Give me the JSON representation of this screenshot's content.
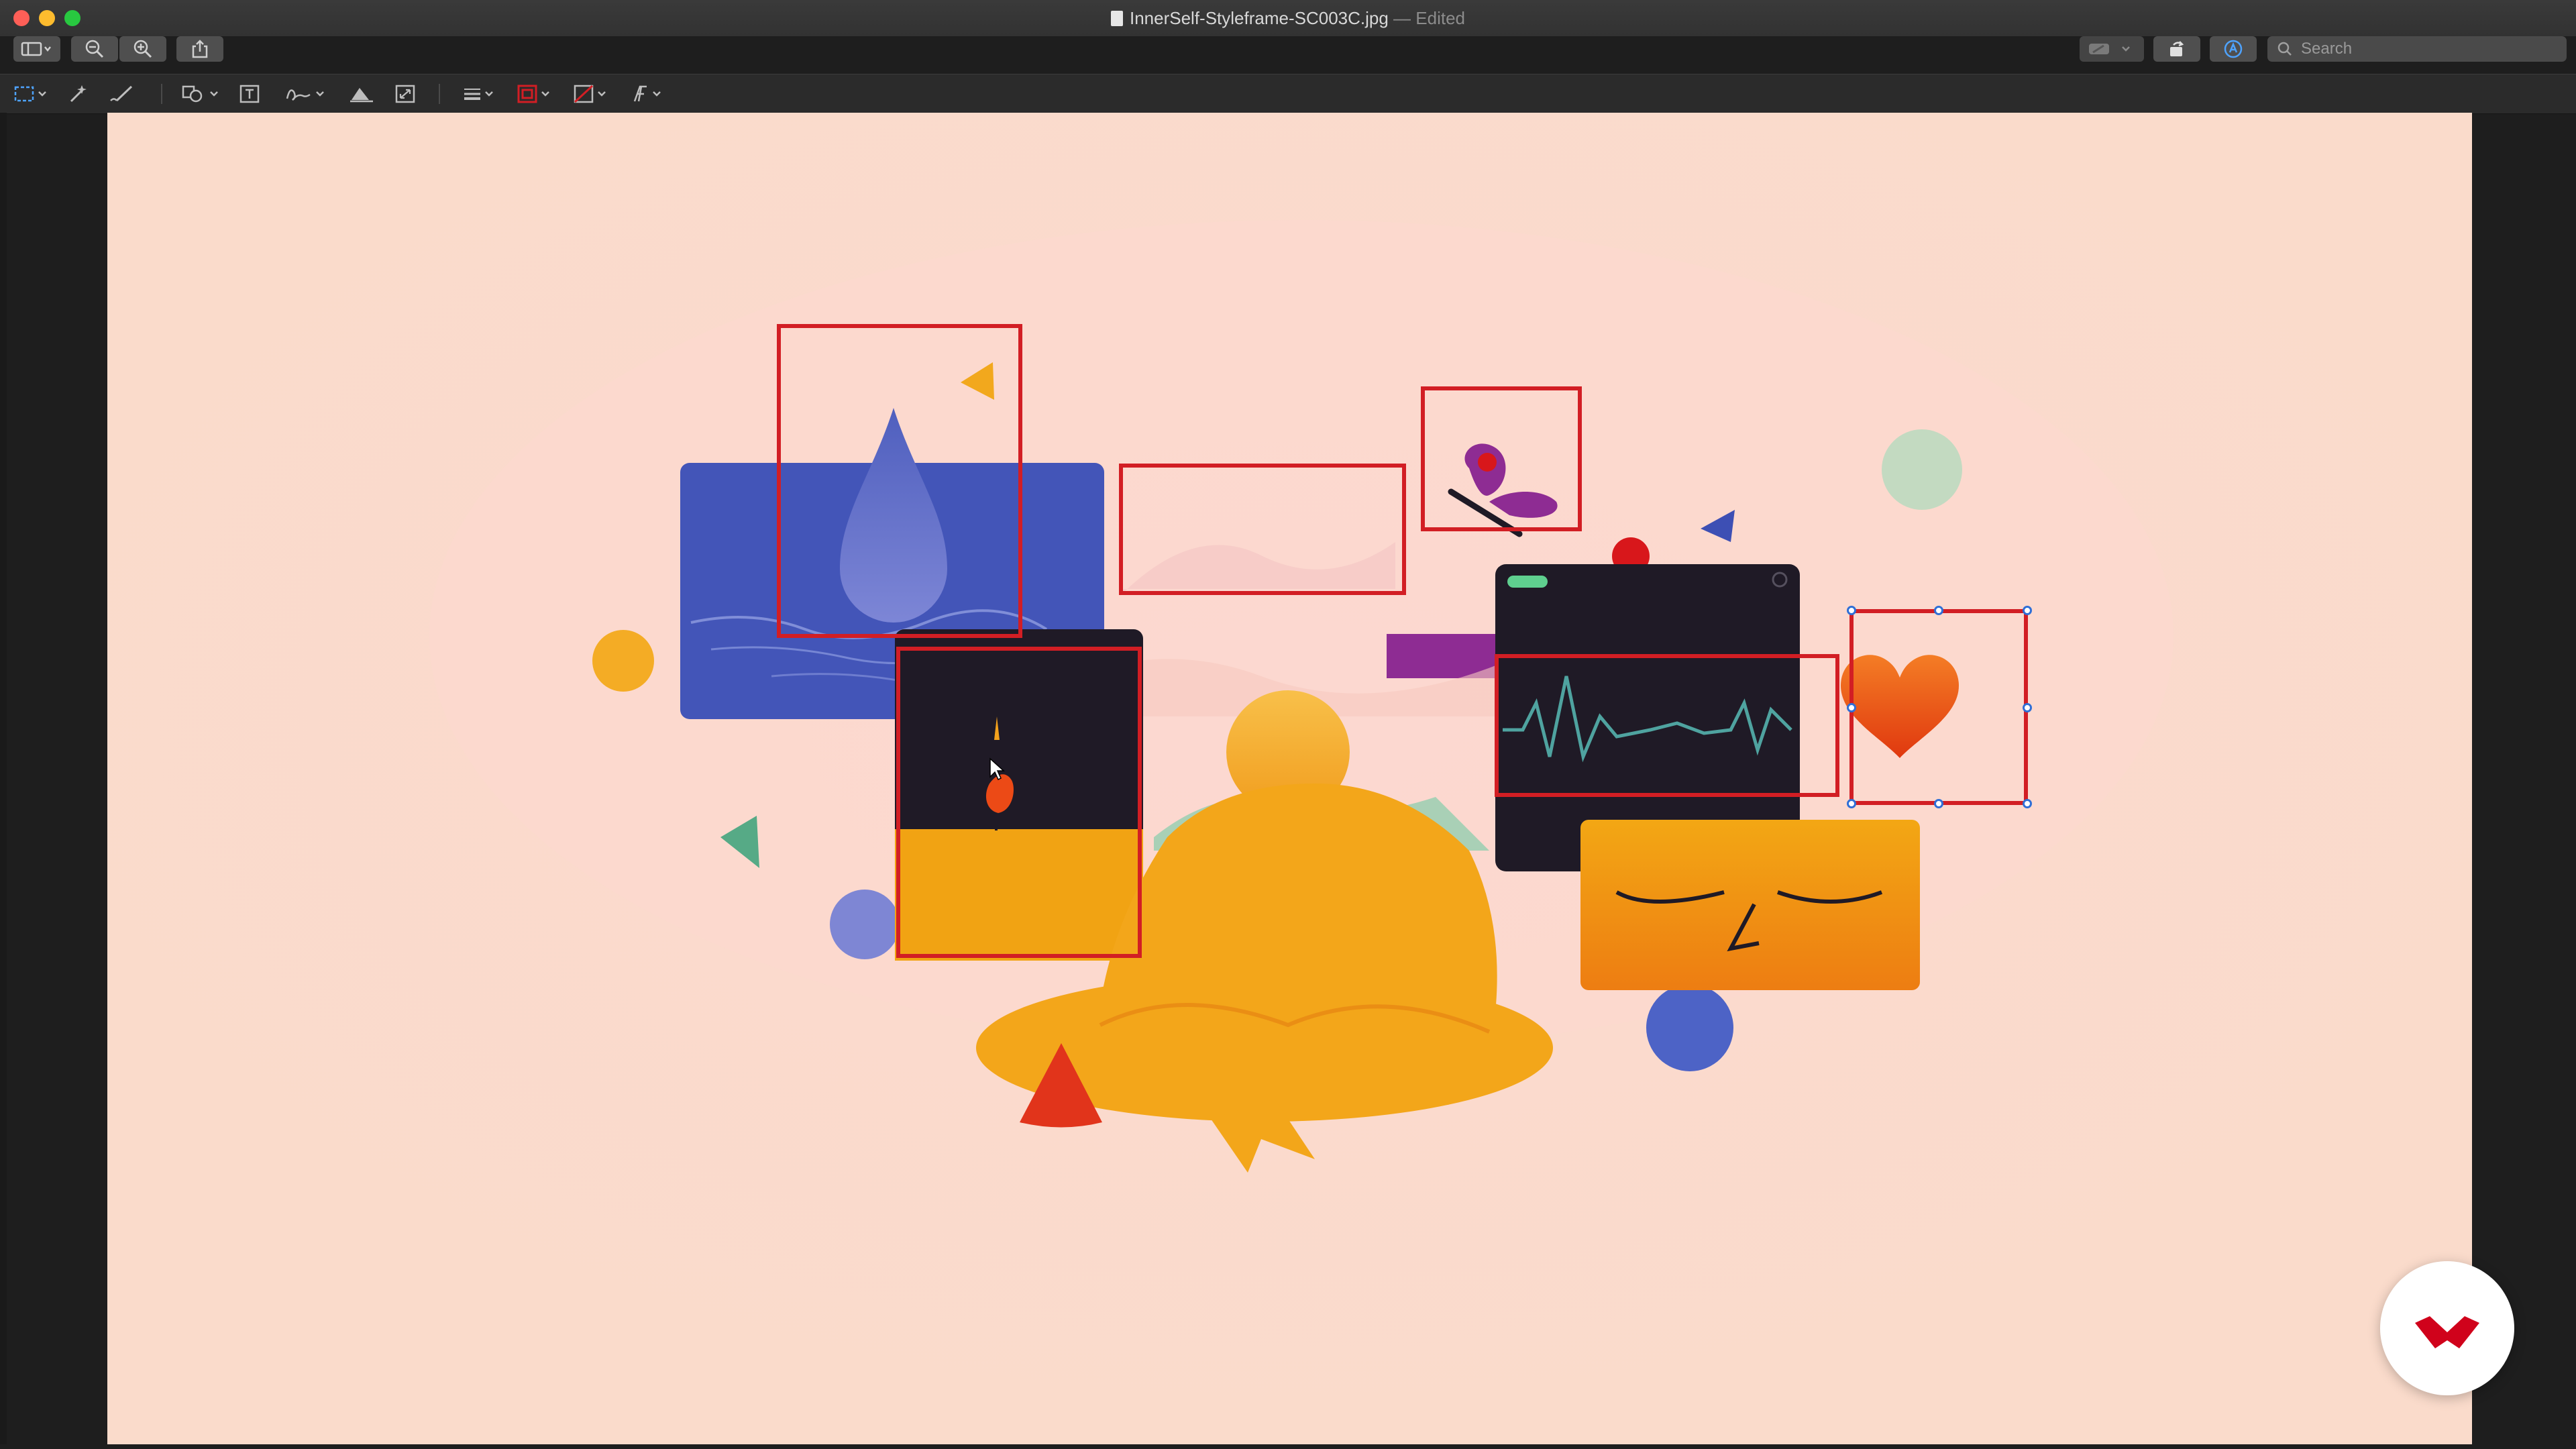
{
  "window": {
    "title": "InnerSelf-Styleframe-SC003C.jpg",
    "separator": "—",
    "status": "Edited",
    "close_color": "#fe5f57",
    "minimize_color": "#febc2e",
    "zoom_color": "#28c840"
  },
  "toolbar": {
    "search_placeholder": "Search",
    "buttons": [
      "sidebar-toggle-icon",
      "zoom-out-icon",
      "zoom-in-icon",
      "share-icon",
      "highlight-pen-icon",
      "rotate-icon",
      "markup-icon"
    ]
  },
  "markup_toolbar": {
    "tools": [
      "rect-selection-icon",
      "instant-alpha-icon",
      "sketch-icon",
      "shapes-icon",
      "text-icon",
      "sign-icon",
      "adjust-color-icon",
      "adjust-size-icon",
      "shape-style-icon",
      "border-color-icon",
      "fill-color-icon",
      "text-style-icon"
    ],
    "border_color": "#d21e24"
  },
  "artwork": {
    "background": "#fadbcb",
    "annotation_color": "#d21e24",
    "selection_handle_color": "#2f6fd6"
  },
  "watermark": {
    "icon": "domestika-logo-icon",
    "color": "#d0021b"
  }
}
